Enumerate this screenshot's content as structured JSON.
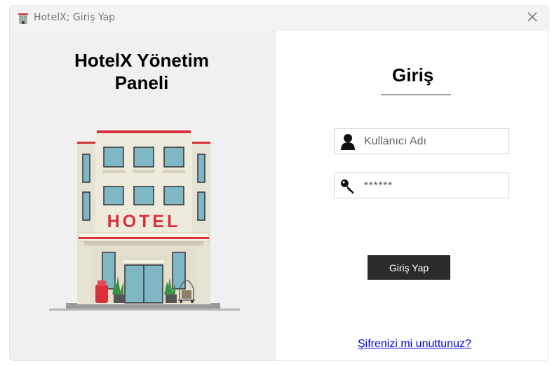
{
  "window": {
    "title": "HotelX; Giriş Yap"
  },
  "left_panel": {
    "heading_line1": "HotelX Yönetim",
    "heading_line2": "Paneli",
    "illustration_sign": "HOTEL"
  },
  "login": {
    "title": "Giriş",
    "username_placeholder": "Kullanıcı Adı",
    "password_value": "******",
    "submit_label": "Giriş Yap",
    "forgot_link": "Şifrenizi mi unuttunuz?"
  },
  "icons": {
    "app": "hotel-building-icon",
    "close": "close-icon",
    "user": "user-icon",
    "key": "key-icon"
  },
  "colors": {
    "left_panel_bg": "#f0f0f0",
    "button_bg": "#2b2b2b",
    "link": "#0000ee",
    "hotel_sign": "#d9303c"
  }
}
